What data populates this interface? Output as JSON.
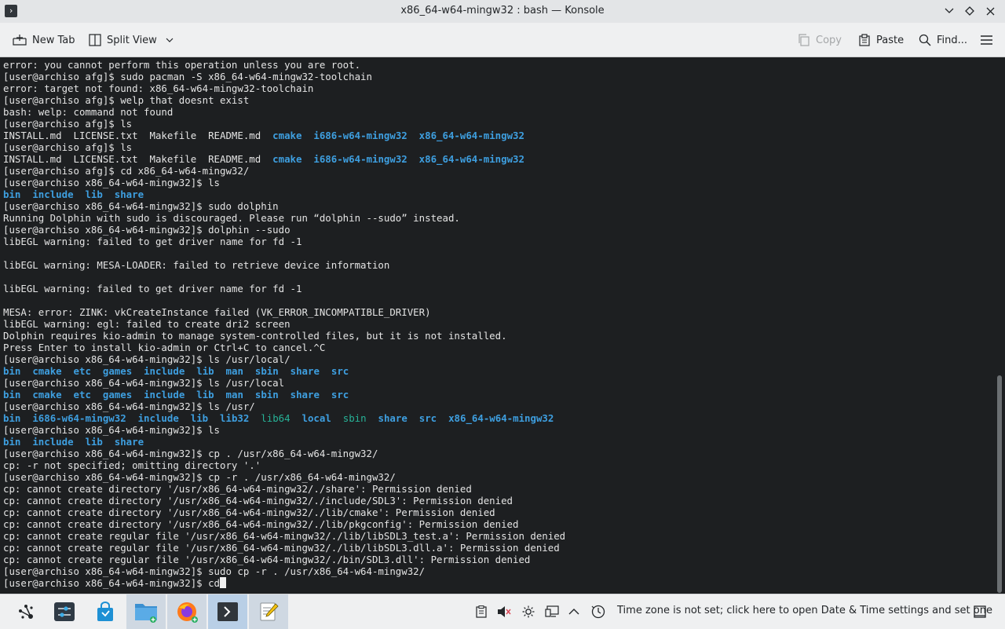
{
  "window": {
    "title": "x86_64-w64-mingw32 : bash — Konsole",
    "app_icon_glyph": "›"
  },
  "toolbar": {
    "new_tab": "New Tab",
    "split_view": "Split View",
    "copy": "Copy",
    "paste": "Paste",
    "find": "Find..."
  },
  "terminal": {
    "lines": [
      [
        {
          "t": "error: you cannot perform this operation unless you are root."
        }
      ],
      [
        {
          "t": "[user@archiso afg]$ sudo pacman -S x86_64-w64-mingw32-toolchain"
        }
      ],
      [
        {
          "t": "error: target not found: x86_64-w64-mingw32-toolchain"
        }
      ],
      [
        {
          "t": "[user@archiso afg]$ welp that doesnt exist"
        }
      ],
      [
        {
          "t": "bash: welp: command not found"
        }
      ],
      [
        {
          "t": "[user@archiso afg]$ ls"
        }
      ],
      [
        {
          "t": "INSTALL.md  LICENSE.txt  Makefile  README.md  "
        },
        {
          "t": "cmake",
          "c": "dir"
        },
        {
          "t": "  "
        },
        {
          "t": "i686-w64-mingw32",
          "c": "dir"
        },
        {
          "t": "  "
        },
        {
          "t": "x86_64-w64-mingw32",
          "c": "dir"
        }
      ],
      [
        {
          "t": "[user@archiso afg]$ ls"
        }
      ],
      [
        {
          "t": "INSTALL.md  LICENSE.txt  Makefile  README.md  "
        },
        {
          "t": "cmake",
          "c": "dir"
        },
        {
          "t": "  "
        },
        {
          "t": "i686-w64-mingw32",
          "c": "dir"
        },
        {
          "t": "  "
        },
        {
          "t": "x86_64-w64-mingw32",
          "c": "dir"
        }
      ],
      [
        {
          "t": "[user@archiso afg]$ cd x86_64-w64-mingw32/"
        }
      ],
      [
        {
          "t": "[user@archiso x86_64-w64-mingw32]$ ls"
        }
      ],
      [
        {
          "t": "bin",
          "c": "dir"
        },
        {
          "t": "  "
        },
        {
          "t": "include",
          "c": "dir"
        },
        {
          "t": "  "
        },
        {
          "t": "lib",
          "c": "dir"
        },
        {
          "t": "  "
        },
        {
          "t": "share",
          "c": "dir"
        }
      ],
      [
        {
          "t": "[user@archiso x86_64-w64-mingw32]$ sudo dolphin"
        }
      ],
      [
        {
          "t": "Running Dolphin with sudo is discouraged. Please run “dolphin --sudo” instead."
        }
      ],
      [
        {
          "t": "[user@archiso x86_64-w64-mingw32]$ dolphin --sudo"
        }
      ],
      [
        {
          "t": "libEGL warning: failed to get driver name for fd -1"
        }
      ],
      [
        {
          "t": ""
        }
      ],
      [
        {
          "t": "libEGL warning: MESA-LOADER: failed to retrieve device information"
        }
      ],
      [
        {
          "t": ""
        }
      ],
      [
        {
          "t": "libEGL warning: failed to get driver name for fd -1"
        }
      ],
      [
        {
          "t": ""
        }
      ],
      [
        {
          "t": "MESA: error: ZINK: vkCreateInstance failed (VK_ERROR_INCOMPATIBLE_DRIVER)"
        }
      ],
      [
        {
          "t": "libEGL warning: egl: failed to create dri2 screen"
        }
      ],
      [
        {
          "t": "Dolphin requires kio-admin to manage system-controlled files, but it is not installed."
        }
      ],
      [
        {
          "t": "Press Enter to install kio-admin or Ctrl+C to cancel.^C"
        }
      ],
      [
        {
          "t": "[user@archiso x86_64-w64-mingw32]$ ls /usr/local/"
        }
      ],
      [
        {
          "t": "bin",
          "c": "dir"
        },
        {
          "t": "  "
        },
        {
          "t": "cmake",
          "c": "dir"
        },
        {
          "t": "  "
        },
        {
          "t": "etc",
          "c": "dir"
        },
        {
          "t": "  "
        },
        {
          "t": "games",
          "c": "dir"
        },
        {
          "t": "  "
        },
        {
          "t": "include",
          "c": "dir"
        },
        {
          "t": "  "
        },
        {
          "t": "lib",
          "c": "dir"
        },
        {
          "t": "  "
        },
        {
          "t": "man",
          "c": "dir"
        },
        {
          "t": "  "
        },
        {
          "t": "sbin",
          "c": "dir"
        },
        {
          "t": "  "
        },
        {
          "t": "share",
          "c": "dir"
        },
        {
          "t": "  "
        },
        {
          "t": "src",
          "c": "dir"
        }
      ],
      [
        {
          "t": "[user@archiso x86_64-w64-mingw32]$ ls /usr/local"
        }
      ],
      [
        {
          "t": "bin",
          "c": "dir"
        },
        {
          "t": "  "
        },
        {
          "t": "cmake",
          "c": "dir"
        },
        {
          "t": "  "
        },
        {
          "t": "etc",
          "c": "dir"
        },
        {
          "t": "  "
        },
        {
          "t": "games",
          "c": "dir"
        },
        {
          "t": "  "
        },
        {
          "t": "include",
          "c": "dir"
        },
        {
          "t": "  "
        },
        {
          "t": "lib",
          "c": "dir"
        },
        {
          "t": "  "
        },
        {
          "t": "man",
          "c": "dir"
        },
        {
          "t": "  "
        },
        {
          "t": "sbin",
          "c": "dir"
        },
        {
          "t": "  "
        },
        {
          "t": "share",
          "c": "dir"
        },
        {
          "t": "  "
        },
        {
          "t": "src",
          "c": "dir"
        }
      ],
      [
        {
          "t": "[user@archiso x86_64-w64-mingw32]$ ls /usr/"
        }
      ],
      [
        {
          "t": "bin",
          "c": "dir"
        },
        {
          "t": "  "
        },
        {
          "t": "i686-w64-mingw32",
          "c": "dir"
        },
        {
          "t": "  "
        },
        {
          "t": "include",
          "c": "dir"
        },
        {
          "t": "  "
        },
        {
          "t": "lib",
          "c": "dir"
        },
        {
          "t": "  "
        },
        {
          "t": "lib32",
          "c": "dir"
        },
        {
          "t": "  "
        },
        {
          "t": "lib64",
          "c": "green"
        },
        {
          "t": "  "
        },
        {
          "t": "local",
          "c": "dir"
        },
        {
          "t": "  "
        },
        {
          "t": "sbin",
          "c": "green"
        },
        {
          "t": "  "
        },
        {
          "t": "share",
          "c": "dir"
        },
        {
          "t": "  "
        },
        {
          "t": "src",
          "c": "dir"
        },
        {
          "t": "  "
        },
        {
          "t": "x86_64-w64-mingw32",
          "c": "dir"
        }
      ],
      [
        {
          "t": "[user@archiso x86_64-w64-mingw32]$ ls"
        }
      ],
      [
        {
          "t": "bin",
          "c": "dir"
        },
        {
          "t": "  "
        },
        {
          "t": "include",
          "c": "dir"
        },
        {
          "t": "  "
        },
        {
          "t": "lib",
          "c": "dir"
        },
        {
          "t": "  "
        },
        {
          "t": "share",
          "c": "dir"
        }
      ],
      [
        {
          "t": "[user@archiso x86_64-w64-mingw32]$ cp . /usr/x86_64-w64-mingw32/"
        }
      ],
      [
        {
          "t": "cp: -r not specified; omitting directory '.'"
        }
      ],
      [
        {
          "t": "[user@archiso x86_64-w64-mingw32]$ cp -r . /usr/x86_64-w64-mingw32/"
        }
      ],
      [
        {
          "t": "cp: cannot create directory '/usr/x86_64-w64-mingw32/./share': Permission denied"
        }
      ],
      [
        {
          "t": "cp: cannot create directory '/usr/x86_64-w64-mingw32/./include/SDL3': Permission denied"
        }
      ],
      [
        {
          "t": "cp: cannot create directory '/usr/x86_64-w64-mingw32/./lib/cmake': Permission denied"
        }
      ],
      [
        {
          "t": "cp: cannot create directory '/usr/x86_64-w64-mingw32/./lib/pkgconfig': Permission denied"
        }
      ],
      [
        {
          "t": "cp: cannot create regular file '/usr/x86_64-w64-mingw32/./lib/libSDL3_test.a': Permission denied"
        }
      ],
      [
        {
          "t": "cp: cannot create regular file '/usr/x86_64-w64-mingw32/./lib/libSDL3.dll.a': Permission denied"
        }
      ],
      [
        {
          "t": "cp: cannot create regular file '/usr/x86_64-w64-mingw32/./bin/SDL3.dll': Permission denied"
        }
      ],
      [
        {
          "t": "[user@archiso x86_64-w64-mingw32]$ sudo cp -r . /usr/x86_64-w64-mingw32/"
        }
      ],
      [
        {
          "t": "[user@archiso x86_64-w64-mingw32]$ cd"
        },
        {
          "t": "",
          "c": "cursor"
        }
      ]
    ]
  },
  "taskbar": {
    "apps": [
      {
        "name": "app-launcher",
        "icon": "kde-launcher-icon"
      },
      {
        "name": "system-settings",
        "icon": "settings-sliders-icon"
      },
      {
        "name": "discover",
        "icon": "store-bag-icon"
      },
      {
        "name": "dolphin",
        "icon": "folder-icon"
      },
      {
        "name": "firefox",
        "icon": "firefox-icon"
      },
      {
        "name": "konsole",
        "icon": "terminal-icon"
      },
      {
        "name": "kate",
        "icon": "text-editor-icon"
      }
    ],
    "clock_text": "Time zone is not set; click here to open Date & Time settings and set one"
  },
  "colors": {
    "terminal_bg": "#1d1f21",
    "terminal_fg": "#e4e4e4",
    "directory": "#3e9fe0",
    "green_dir": "#27b398",
    "panel_bg": "#eff0f1",
    "active_task": "#b9cfe6"
  }
}
